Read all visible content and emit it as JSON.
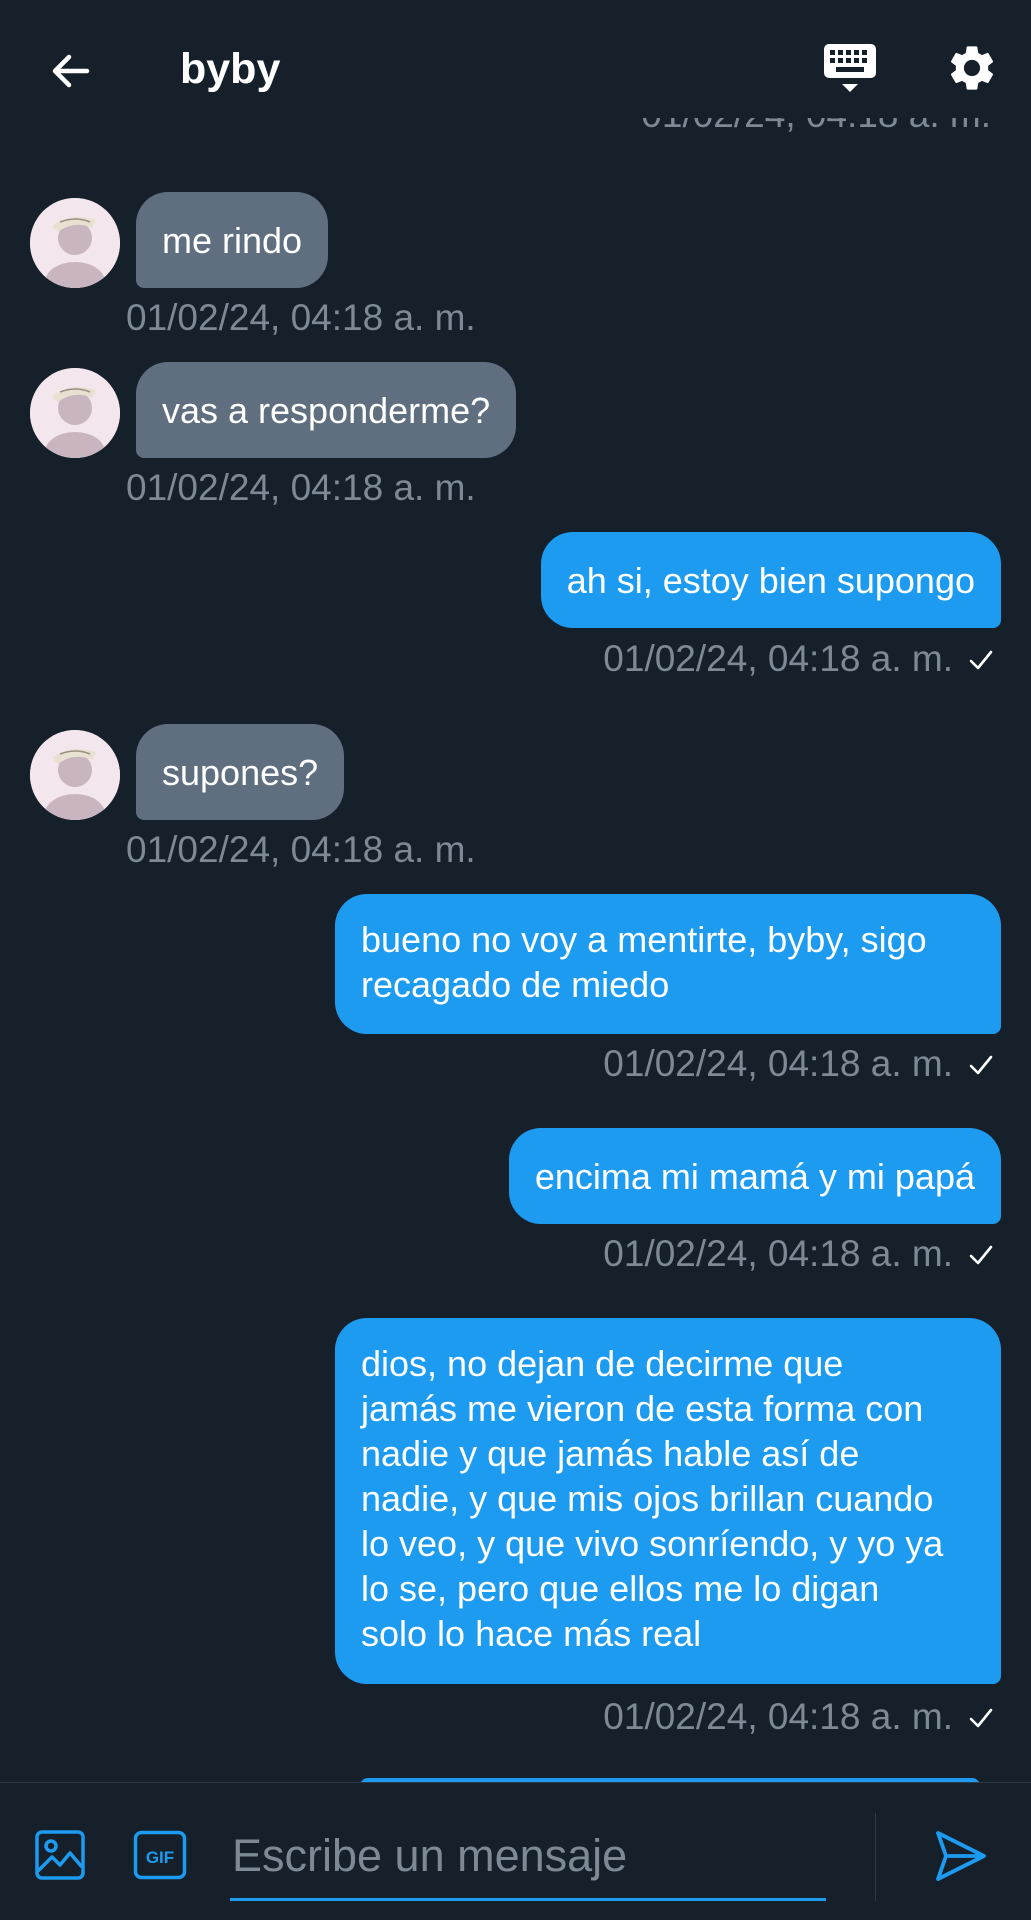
{
  "header": {
    "title": "byby",
    "ghost_timestamp": "01/02/24, 04:18 a. m."
  },
  "messages": [
    {
      "side": "in",
      "text": "me rindo",
      "time": "01/02/24, 04:18 a. m."
    },
    {
      "side": "in",
      "text": "vas a responderme?",
      "time": "01/02/24, 04:18 a. m."
    },
    {
      "side": "out",
      "text": "ah si, estoy bien supongo",
      "time": "01/02/24, 04:18 a. m.",
      "read": true
    },
    {
      "side": "in",
      "text": "supones?",
      "time": "01/02/24, 04:18 a. m."
    },
    {
      "side": "out",
      "text_lines": [
        "bueno no voy a mentirte, byby, sigo",
        "recagado de miedo"
      ],
      "time": "01/02/24, 04:18 a. m.",
      "read": true
    },
    {
      "side": "out",
      "text": "encima mi mamá y mi papá",
      "time": "01/02/24, 04:18 a. m.",
      "read": true
    },
    {
      "side": "out",
      "text_lines": [
        "dios, no dejan de decirme que",
        "jamás me vieron de esta forma con",
        "nadie y que jamás hable así de",
        "nadie, y que mis ojos brillan cuando",
        "lo veo, y que vivo sonríendo, y yo ya",
        "lo se, pero que ellos me lo digan",
        "solo lo hace más real"
      ],
      "time": "01/02/24, 04:18 a. m.",
      "read": true
    }
  ],
  "composer": {
    "placeholder": "Escribe un mensaje",
    "gif_label": "GIF"
  },
  "colors": {
    "background": "#15202b",
    "outgoing_bubble": "#1d9bf0",
    "incoming_bubble": "#5f6f7f",
    "timestamp": "#7d8a96"
  },
  "icons": [
    "back-arrow-icon",
    "keyboard-icon",
    "gear-icon",
    "image-icon",
    "gif-icon",
    "send-icon",
    "check-icon"
  ]
}
